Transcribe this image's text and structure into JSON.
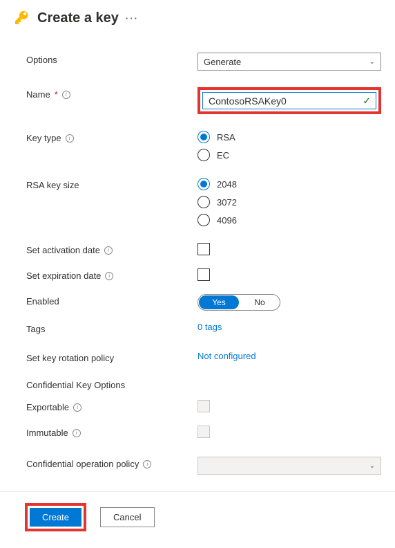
{
  "header": {
    "title": "Create a key"
  },
  "labels": {
    "options": "Options",
    "name": "Name",
    "keyType": "Key type",
    "rsaKeySize": "RSA key size",
    "setActivation": "Set activation date",
    "setExpiration": "Set expiration date",
    "enabled": "Enabled",
    "tags": "Tags",
    "rotationPolicy": "Set key rotation policy",
    "confidentialSection": "Confidential Key Options",
    "exportable": "Exportable",
    "immutable": "Immutable",
    "confidentialPolicy": "Confidential operation policy"
  },
  "values": {
    "optionsSelected": "Generate",
    "name": "ContosoRSAKey0",
    "keyType": {
      "rsa": "RSA",
      "ec": "EC",
      "selected": "RSA"
    },
    "rsaSizes": {
      "a": "2048",
      "b": "3072",
      "c": "4096",
      "selected": "2048"
    },
    "enabled": {
      "yes": "Yes",
      "no": "No",
      "selected": "Yes"
    },
    "tagsText": "0 tags",
    "rotationText": "Not configured"
  },
  "buttons": {
    "create": "Create",
    "cancel": "Cancel"
  }
}
